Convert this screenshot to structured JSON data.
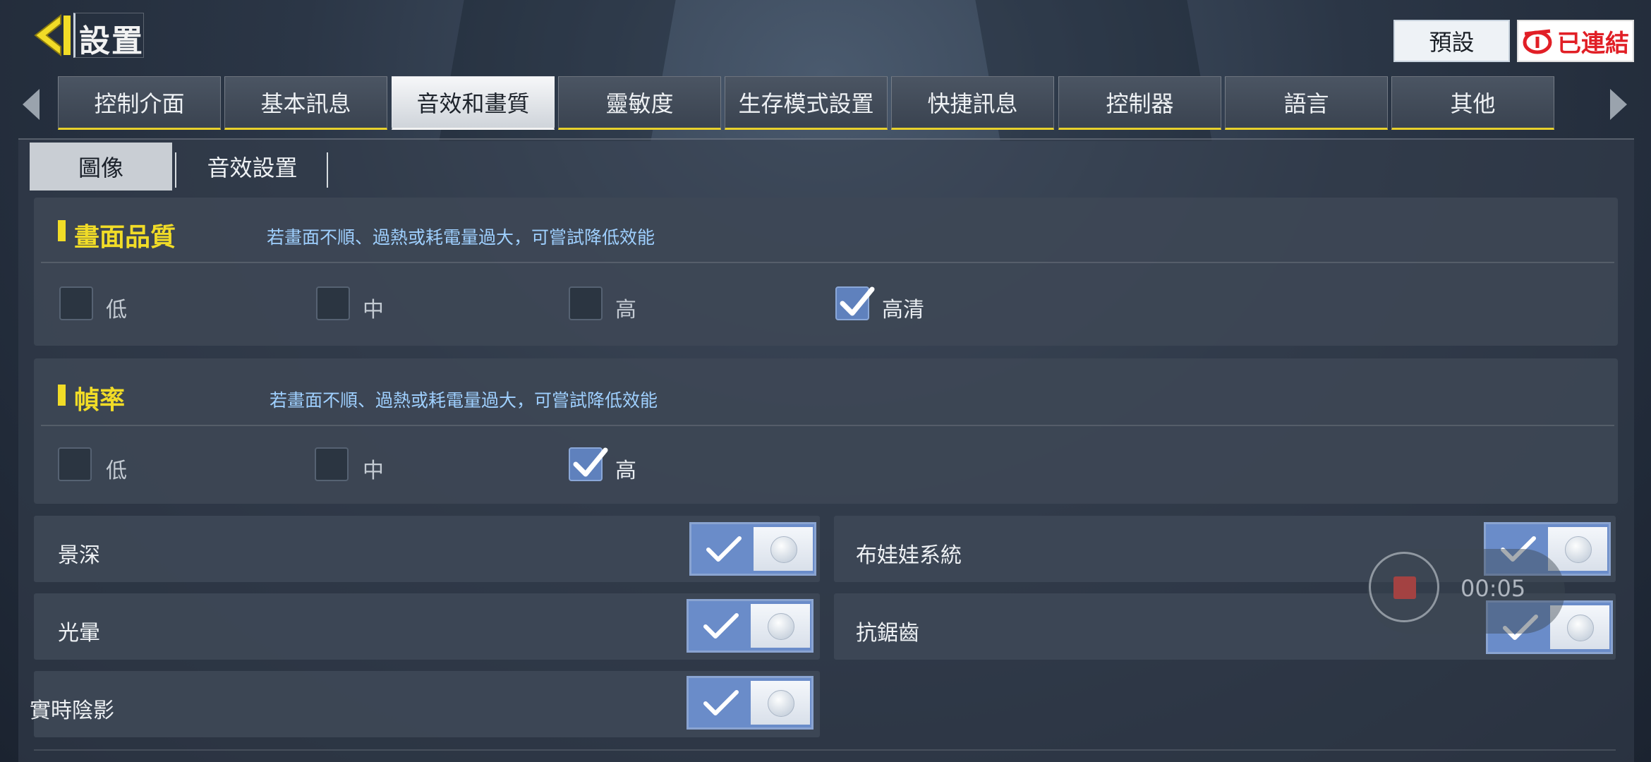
{
  "header": {
    "title": "設置",
    "preset_label": "預設",
    "connected_label": "已連結",
    "back_icon": "back-arrow-icon",
    "accent": "#f1dc27"
  },
  "tabs": [
    {
      "label": "控制介面"
    },
    {
      "label": "基本訊息"
    },
    {
      "label": "音效和畫質",
      "active": true
    },
    {
      "label": "靈敏度"
    },
    {
      "label": "生存模式設置"
    },
    {
      "label": "快捷訊息"
    },
    {
      "label": "控制器"
    },
    {
      "label": "語言"
    },
    {
      "label": "其他"
    }
  ],
  "subtabs": [
    {
      "label": "圖像",
      "active": true
    },
    {
      "label": "音效設置"
    }
  ],
  "quality": {
    "title": "畫面品質",
    "hint": "若畫面不順、過熱或耗電量過大，可嘗試降低效能",
    "options": [
      "低",
      "中",
      "高",
      "高清"
    ],
    "selected": "高清"
  },
  "framerate": {
    "title": "幀率",
    "hint": "若畫面不順、過熱或耗電量過大，可嘗試降低效能",
    "options": [
      "低",
      "中",
      "高"
    ],
    "selected": "高"
  },
  "toggles": {
    "depth_of_field": {
      "label": "景深",
      "on": true
    },
    "ragdoll": {
      "label": "布娃娃系統",
      "on": true
    },
    "bloom": {
      "label": "光暈",
      "on": true
    },
    "antialiasing": {
      "label": "抗鋸齒",
      "on": true
    },
    "realtime_shadows": {
      "label": "實時陰影",
      "on": true
    }
  },
  "recording": {
    "time": "00:05"
  }
}
